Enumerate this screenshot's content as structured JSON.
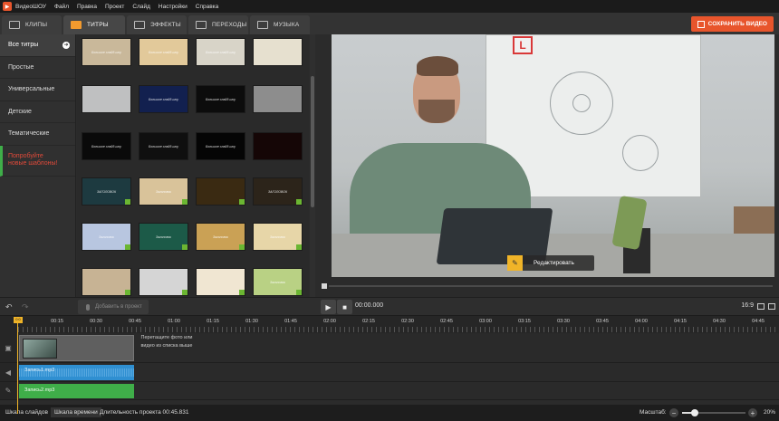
{
  "app": {
    "title": "ВидеоШОУ"
  },
  "menu": [
    "Файл",
    "Правка",
    "Проект",
    "Слайд",
    "Настройки",
    "Справка"
  ],
  "tabs": [
    {
      "label": "КЛИПЫ",
      "icon": "clips-icon",
      "active": false
    },
    {
      "label": "ТИТРЫ",
      "icon": "titles-icon",
      "active": true
    },
    {
      "label": "ЭФФЕКТЫ",
      "icon": "effects-icon",
      "active": false
    },
    {
      "label": "ПЕРЕХОДЫ",
      "icon": "transitions-icon",
      "active": false
    },
    {
      "label": "МУЗЫКА",
      "icon": "music-icon",
      "active": false
    }
  ],
  "save_button": "СОХРАНИТЬ ВИДЕО",
  "categories": [
    "Все титры",
    "Простые",
    "Универсальные",
    "Детские",
    "Тематические"
  ],
  "promo": "Попробуйте\nновые шаблоны!",
  "templates": [
    {
      "text": "Большое слайд-шоу",
      "bg": "#c9b89a",
      "download": false
    },
    {
      "text": "Большое слайд-шоу",
      "bg": "#e2c99a",
      "download": false
    },
    {
      "text": "Большое слайд-шоу",
      "bg": "#d8d4c8",
      "download": false
    },
    {
      "text": "",
      "bg": "#e6e0cf",
      "download": false
    },
    {
      "text": "",
      "bg": "#bfc0c1",
      "download": false
    },
    {
      "text": "Большое слайд-шоу",
      "bg": "#12204f",
      "download": false
    },
    {
      "text": "Большое слайд-шоу",
      "bg": "#0c0c0c",
      "download": false
    },
    {
      "text": "",
      "bg": "#8d8d8d",
      "download": false
    },
    {
      "text": "Большое слайд-шоу",
      "bg": "#0a0a0a",
      "download": false
    },
    {
      "text": "Большое слайд-шоу",
      "bg": "#0f0f0f",
      "download": false
    },
    {
      "text": "Большое слайд-шоу",
      "bg": "#050505",
      "download": false
    },
    {
      "text": "",
      "bg": "#150606",
      "download": false
    },
    {
      "text": "ЗАГОЛОВОК",
      "bg": "#1d3a40",
      "download": true
    },
    {
      "text": "Заголовок",
      "bg": "#d9c39a",
      "download": true
    },
    {
      "text": "",
      "bg": "#3a2a12",
      "download": true
    },
    {
      "text": "ЗАГОЛОВОК",
      "bg": "#2c241a",
      "download": true
    },
    {
      "text": "Заголовок",
      "bg": "#b8c6e0",
      "download": true
    },
    {
      "text": "Заголовок",
      "bg": "#1c5a48",
      "download": true
    },
    {
      "text": "Заголовок",
      "bg": "#caa155",
      "download": true
    },
    {
      "text": "Заголовок",
      "bg": "#e7d6a8",
      "download": true
    },
    {
      "text": "",
      "bg": "#c7b394",
      "download": true
    },
    {
      "text": "",
      "bg": "#d5d5d5",
      "download": true
    },
    {
      "text": "",
      "bg": "#f0e6d2",
      "download": true
    },
    {
      "text": "Заголовок",
      "bg": "#b9d184",
      "download": true
    }
  ],
  "preview": {
    "edit_label": "Редактировать",
    "sign_letter": "L"
  },
  "playback": {
    "add_label": "Добавить в проект",
    "timecode": "00:00.000",
    "ratio": "16:9"
  },
  "ruler": {
    "cursor_label": "0:0",
    "labels": [
      "00:15",
      "00:30",
      "00:45",
      "01:00",
      "01:15",
      "01:30",
      "01:45",
      "02:00",
      "02:15",
      "02:30",
      "02:45",
      "03:00",
      "03:15",
      "03:30",
      "03:45",
      "04:00",
      "04:15",
      "04:30",
      "04:45"
    ]
  },
  "timeline": {
    "drop_hint": "Перетащите фото или видео из списка выше",
    "audio1_label": "Запись1.mp3",
    "audio2_label": "Запись2.mp3"
  },
  "status": {
    "tab1": "Шкала слайдов",
    "tab2": "Шкала времени",
    "duration": "Длительность проекта 00:45.831",
    "zoom_label": "Масштаб:",
    "zoom_value": "20%",
    "zoom_fraction": 0.2
  },
  "colors": {
    "accent": "#e8552c",
    "gold": "#f0b428",
    "promo": "#e14a3a",
    "audio1": "#2f8fd1",
    "audio2": "#3fae49"
  }
}
